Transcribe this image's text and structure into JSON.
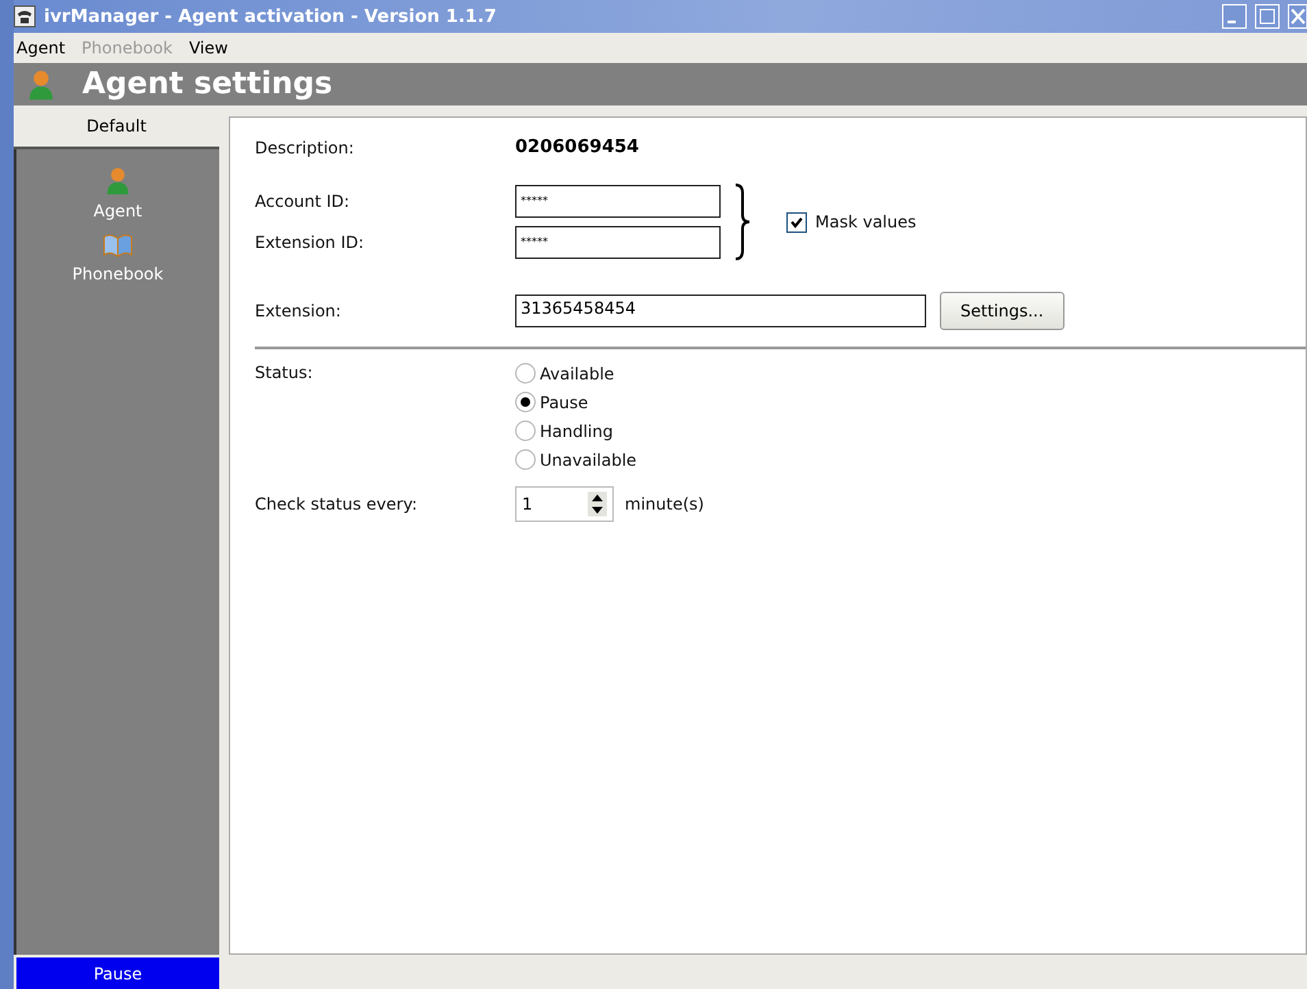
{
  "window": {
    "title": "ivrManager - Agent activation - Version 1.1.7"
  },
  "menu": [
    {
      "label": "Agent",
      "disabled": false
    },
    {
      "label": "Phonebook",
      "disabled": true
    },
    {
      "label": "View",
      "disabled": false
    }
  ],
  "header": {
    "title": "Agent settings"
  },
  "sidebar": {
    "group": "Default",
    "items": [
      {
        "kind": "agent",
        "label": "Agent"
      },
      {
        "kind": "book",
        "label": "Phonebook"
      }
    ]
  },
  "form": {
    "description_label": "Description:",
    "description": "0206069454",
    "account_label": "Account ID:",
    "account_value": "*****",
    "extension_id_label": "Extension ID:",
    "extension_id_value": "*****",
    "mask": {
      "label": "Mask values",
      "checked": true
    },
    "extension_label": "Extension:",
    "extension_value": "31365458454",
    "settings_button": "Settings...",
    "status_label": "Status:",
    "statuses": [
      {
        "label": "Available",
        "selected": false
      },
      {
        "label": "Pause",
        "selected": true
      },
      {
        "label": "Handling",
        "selected": false
      },
      {
        "label": "Unavailable",
        "selected": false
      }
    ],
    "interval_label": "Check status every:",
    "interval_value": "1",
    "interval_unit": "minute(s)"
  },
  "status_bar": {
    "status": "Pause"
  }
}
